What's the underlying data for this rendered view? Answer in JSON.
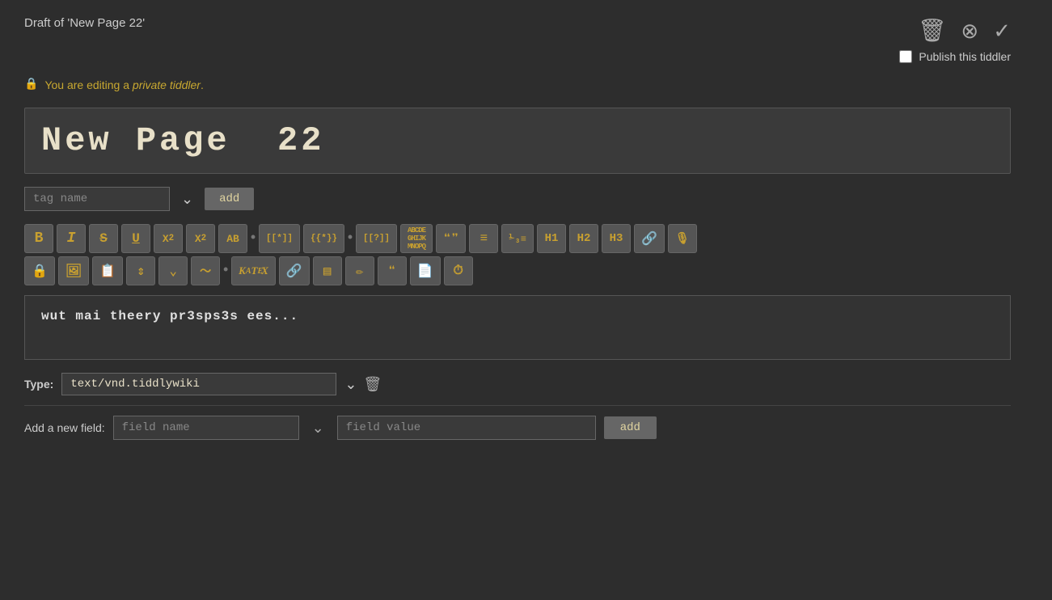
{
  "header": {
    "draft_title": "Draft of 'New Page 22'",
    "delete_icon": "🗑",
    "cancel_icon": "⊗",
    "confirm_icon": "✓",
    "publish_label": "Publish this tiddler"
  },
  "private_notice": {
    "icon": "🔒",
    "text_before": "You are editing a ",
    "italic_text": "private tiddler",
    "text_after": "."
  },
  "title_section": {
    "page_title": "New Page  22"
  },
  "tag_area": {
    "placeholder": "tag name",
    "add_label": "add"
  },
  "toolbar": {
    "row1": [
      {
        "id": "bold",
        "label": "B",
        "title": "Bold"
      },
      {
        "id": "italic",
        "label": "I",
        "title": "Italic"
      },
      {
        "id": "strikethrough",
        "label": "S̶",
        "title": "Strikethrough"
      },
      {
        "id": "underline",
        "label": "U̲",
        "title": "Underline"
      },
      {
        "id": "superscript",
        "label": "X²",
        "title": "Superscript"
      },
      {
        "id": "subscript",
        "label": "X₂",
        "title": "Subscript"
      },
      {
        "id": "smallcaps",
        "label": "AB",
        "title": "Small Caps"
      },
      {
        "id": "sep1",
        "label": "•",
        "title": "separator"
      },
      {
        "id": "wikilink",
        "label": "[[*]]",
        "title": "Wiki Link"
      },
      {
        "id": "extlink",
        "label": "{{*}}",
        "title": "External Link"
      },
      {
        "id": "sep2",
        "label": "•",
        "title": "separator"
      },
      {
        "id": "translink",
        "label": "[[?]]",
        "title": "Transclusion"
      },
      {
        "id": "macro",
        "label": "ABCDE",
        "title": "Macro"
      },
      {
        "id": "quote",
        "label": "❝❞",
        "title": "Quote"
      },
      {
        "id": "bullet",
        "label": "≡",
        "title": "Bullet list"
      },
      {
        "id": "numlist",
        "label": "⅓≡",
        "title": "Numbered list"
      },
      {
        "id": "h1",
        "label": "H1",
        "title": "Heading 1"
      },
      {
        "id": "h2",
        "label": "H2",
        "title": "Heading 2"
      },
      {
        "id": "h3",
        "label": "H3",
        "title": "Heading 3"
      },
      {
        "id": "link",
        "label": "🔗",
        "title": "Link"
      },
      {
        "id": "waveform",
        "label": "🎙",
        "title": "Waveform"
      }
    ],
    "row2": [
      {
        "id": "lock",
        "label": "🔒",
        "title": "Lock"
      },
      {
        "id": "image",
        "label": "🖼",
        "title": "Image"
      },
      {
        "id": "stamp",
        "label": "📋",
        "title": "Stamp"
      },
      {
        "id": "resize",
        "label": "⇕",
        "title": "Resize"
      },
      {
        "id": "chevron",
        "label": "⌄",
        "title": "Chevron"
      },
      {
        "id": "tilde",
        "label": "〜",
        "title": "Tilde"
      },
      {
        "id": "sep3",
        "label": "•",
        "title": "separator"
      },
      {
        "id": "katex",
        "label": "KaTeX",
        "title": "KaTeX"
      },
      {
        "id": "extlink2",
        "label": "🔗",
        "title": "External link"
      },
      {
        "id": "table",
        "label": "▤",
        "title": "Table"
      },
      {
        "id": "pencil",
        "label": "✏",
        "title": "Edit"
      },
      {
        "id": "quote2",
        "label": "❝",
        "title": "Quote"
      },
      {
        "id": "doc",
        "label": "📄",
        "title": "Document"
      },
      {
        "id": "clock",
        "label": "⏱",
        "title": "Clock"
      }
    ]
  },
  "content": {
    "text": "wut mai theery pr3sps3s ees..."
  },
  "type_row": {
    "label": "Type:",
    "value": "text/vnd.tiddlywiki"
  },
  "field_row": {
    "label": "Add a new field:",
    "name_placeholder": "field name",
    "value_placeholder": "field value",
    "add_label": "add"
  }
}
